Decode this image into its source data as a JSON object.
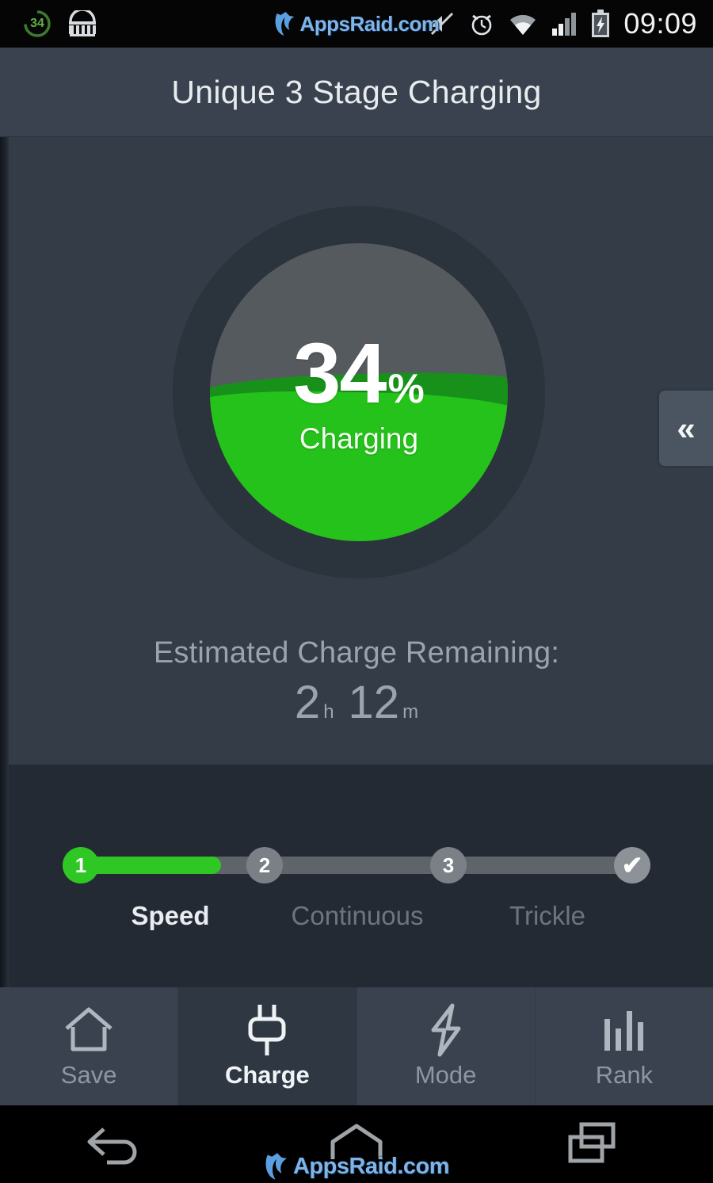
{
  "statusbar": {
    "battery_level_badge": "34",
    "clock": "09:09",
    "icons_left": [
      "battery-percent-ring-icon",
      "basket-icon"
    ],
    "icons_right": [
      "mute-icon",
      "alarm-icon",
      "wifi-icon",
      "signal-icon",
      "battery-charging-icon"
    ],
    "watermark": "AppsRaid.com"
  },
  "header": {
    "title": "Unique 3 Stage Charging"
  },
  "side_tab": {
    "glyph": "«"
  },
  "gauge": {
    "percent": "34",
    "percent_symbol": "%",
    "status": "Charging",
    "fill_level_pct": 34,
    "colors": {
      "ring": "#2b333d",
      "inner": "#555a5e",
      "wave_front": "#25c21b",
      "wave_back": "#17911a"
    }
  },
  "estimate": {
    "label": "Estimated Charge Remaining:",
    "hours": "2",
    "hours_unit": "h",
    "minutes": "12",
    "minutes_unit": "m"
  },
  "stages": {
    "nodes": [
      {
        "badge": "1",
        "state": "active"
      },
      {
        "badge": "2",
        "state": "pending"
      },
      {
        "badge": "3",
        "state": "pending"
      },
      {
        "badge": "✔",
        "state": "done"
      }
    ],
    "labels": [
      {
        "text": "Speed",
        "active": true
      },
      {
        "text": "Continuous",
        "active": false
      },
      {
        "text": "Trickle",
        "active": false
      }
    ],
    "progress_pct": 22,
    "accent": "#2fc723"
  },
  "bottom_nav": [
    {
      "label": "Save",
      "icon": "home-icon",
      "active": false
    },
    {
      "label": "Charge",
      "icon": "plug-icon",
      "active": true
    },
    {
      "label": "Mode",
      "icon": "lightning-icon",
      "active": false
    },
    {
      "label": "Rank",
      "icon": "bar-chart-icon",
      "active": false
    }
  ],
  "android_nav": {
    "buttons": [
      "back-icon",
      "home-icon",
      "recents-icon"
    ],
    "watermark": "AppsRaid.com"
  }
}
